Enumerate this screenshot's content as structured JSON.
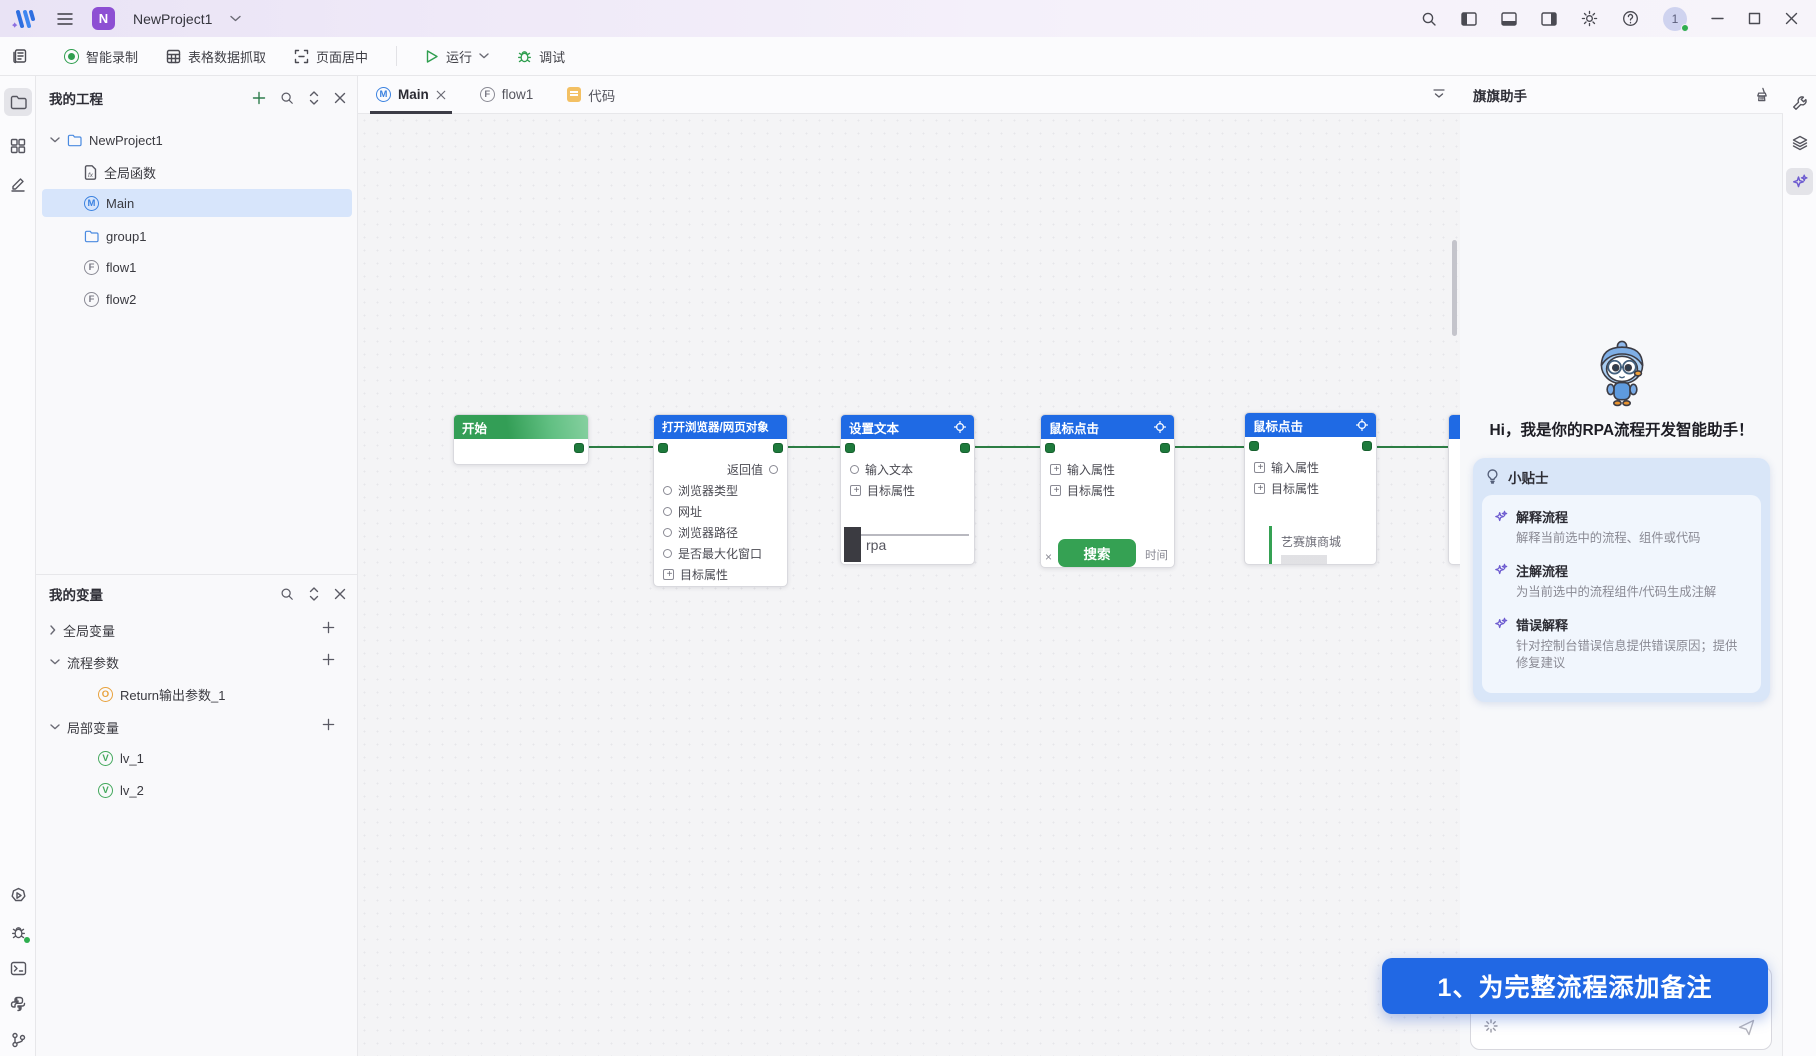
{
  "titlebar": {
    "project_name": "NewProject1",
    "avatar": "1"
  },
  "toolbar": {
    "record": "智能录制",
    "table_capture": "表格数据抓取",
    "center_page": "页面居中",
    "run": "运行",
    "debug": "调试"
  },
  "project_panel": {
    "title": "我的工程",
    "tree": [
      {
        "label": "NewProject1"
      },
      {
        "label": "全局函数"
      },
      {
        "label": "Main"
      },
      {
        "label": "group1"
      },
      {
        "label": "flow1"
      },
      {
        "label": "flow2"
      }
    ]
  },
  "variables_panel": {
    "title": "我的变量",
    "groups": [
      {
        "label": "全局变量"
      },
      {
        "label": "流程参数"
      },
      {
        "label": "局部变量"
      }
    ],
    "items": [
      {
        "label": "Return输出参数_1"
      },
      {
        "label": "lv_1"
      },
      {
        "label": "lv_2"
      }
    ]
  },
  "tabs": [
    {
      "label": "Main"
    },
    {
      "label": "flow1"
    },
    {
      "label": "代码"
    }
  ],
  "nodes": [
    {
      "title": "开始"
    },
    {
      "title": "打开浏览器/网页对象",
      "return_label": "返回值",
      "params": [
        "浏览器类型",
        "网址",
        "浏览器路径",
        "是否最大化窗口",
        "目标属性"
      ]
    },
    {
      "title": "设置文本",
      "params": [
        "输入文本",
        "目标属性"
      ],
      "thumb_text": "rpa"
    },
    {
      "title": "鼠标点击",
      "params": [
        "输入属性",
        "目标属性"
      ],
      "thumb_close": "×",
      "thumb_button": "搜索",
      "thumb_right": "时间"
    },
    {
      "title": "鼠标点击",
      "params": [
        "输入属性",
        "目标属性"
      ],
      "thumb_text": "艺赛旗商城"
    }
  ],
  "assistant": {
    "title": "旗旗助手",
    "greeting": "Hi，我是你的RPA流程开发智能助手！",
    "tips_title": "小贴士",
    "tips": [
      {
        "title": "解释流程",
        "desc": "解释当前选中的流程、组件或代码"
      },
      {
        "title": "注解流程",
        "desc": "为当前选中的流程组件/代码生成注解"
      },
      {
        "title": "错误解释",
        "desc": "针对控制台错误信息提供错误原因；提供修复建议"
      }
    ],
    "banner": "1、为完整流程添加备注"
  },
  "colors": {
    "accent_blue": "#1f6ae4",
    "accent_green": "#2f9e4f",
    "banner_blue": "#2168e4",
    "selection": "#d7e5fb"
  }
}
